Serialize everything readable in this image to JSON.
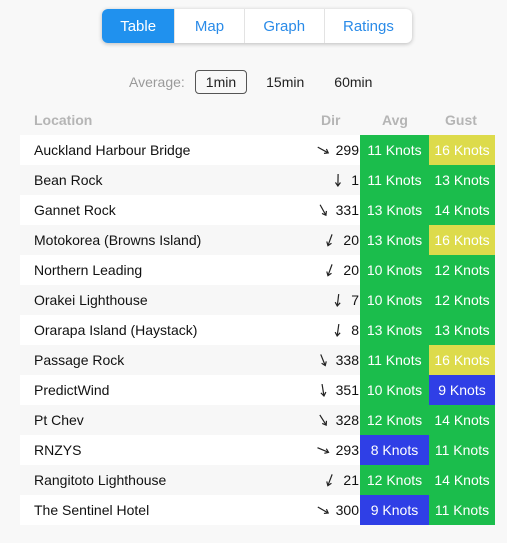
{
  "tabs": [
    {
      "label": "Table",
      "active": true
    },
    {
      "label": "Map",
      "active": false
    },
    {
      "label": "Graph",
      "active": false
    },
    {
      "label": "Ratings",
      "active": false
    }
  ],
  "average": {
    "label": "Average:",
    "options": [
      "1min",
      "15min",
      "60min"
    ],
    "selected": "1min"
  },
  "colors": {
    "green": "#1bbd4c",
    "yellow": "#dddb4b",
    "blue": "#2f3fe6",
    "tab_active": "#2091ee"
  },
  "table": {
    "headers": {
      "location": "Location",
      "dir": "Dir",
      "avg": "Avg",
      "gust": "Gust"
    },
    "rows": [
      {
        "location": "Auckland Harbour Bridge",
        "dir": "299",
        "avg": "11 Knots",
        "avg_color": "green",
        "gust": "16 Knots",
        "gust_color": "yellow"
      },
      {
        "location": "Bean Rock",
        "dir": "1",
        "avg": "11 Knots",
        "avg_color": "green",
        "gust": "13 Knots",
        "gust_color": "green"
      },
      {
        "location": "Gannet Rock",
        "dir": "331",
        "avg": "13 Knots",
        "avg_color": "green",
        "gust": "14 Knots",
        "gust_color": "green"
      },
      {
        "location": "Motokorea (Browns Island)",
        "dir": "20",
        "avg": "13 Knots",
        "avg_color": "green",
        "gust": "16 Knots",
        "gust_color": "yellow"
      },
      {
        "location": "Northern Leading",
        "dir": "20",
        "avg": "10 Knots",
        "avg_color": "green",
        "gust": "12 Knots",
        "gust_color": "green"
      },
      {
        "location": "Orakei Lighthouse",
        "dir": "7",
        "avg": "10 Knots",
        "avg_color": "green",
        "gust": "12 Knots",
        "gust_color": "green"
      },
      {
        "location": "Orarapa Island (Haystack)",
        "dir": "8",
        "avg": "13 Knots",
        "avg_color": "green",
        "gust": "13 Knots",
        "gust_color": "green"
      },
      {
        "location": "Passage Rock",
        "dir": "338",
        "avg": "11 Knots",
        "avg_color": "green",
        "gust": "16 Knots",
        "gust_color": "yellow"
      },
      {
        "location": "PredictWind",
        "dir": "351",
        "avg": "10 Knots",
        "avg_color": "green",
        "gust": "9 Knots",
        "gust_color": "blue"
      },
      {
        "location": "Pt Chev",
        "dir": "328",
        "avg": "12 Knots",
        "avg_color": "green",
        "gust": "14 Knots",
        "gust_color": "green"
      },
      {
        "location": "RNZYS",
        "dir": "293",
        "avg": "8 Knots",
        "avg_color": "blue",
        "gust": "11 Knots",
        "gust_color": "green"
      },
      {
        "location": "Rangitoto Lighthouse",
        "dir": "21",
        "avg": "12 Knots",
        "avg_color": "green",
        "gust": "14 Knots",
        "gust_color": "green"
      },
      {
        "location": "The Sentinel Hotel",
        "dir": "300",
        "avg": "9 Knots",
        "avg_color": "blue",
        "gust": "11 Knots",
        "gust_color": "green"
      }
    ]
  }
}
